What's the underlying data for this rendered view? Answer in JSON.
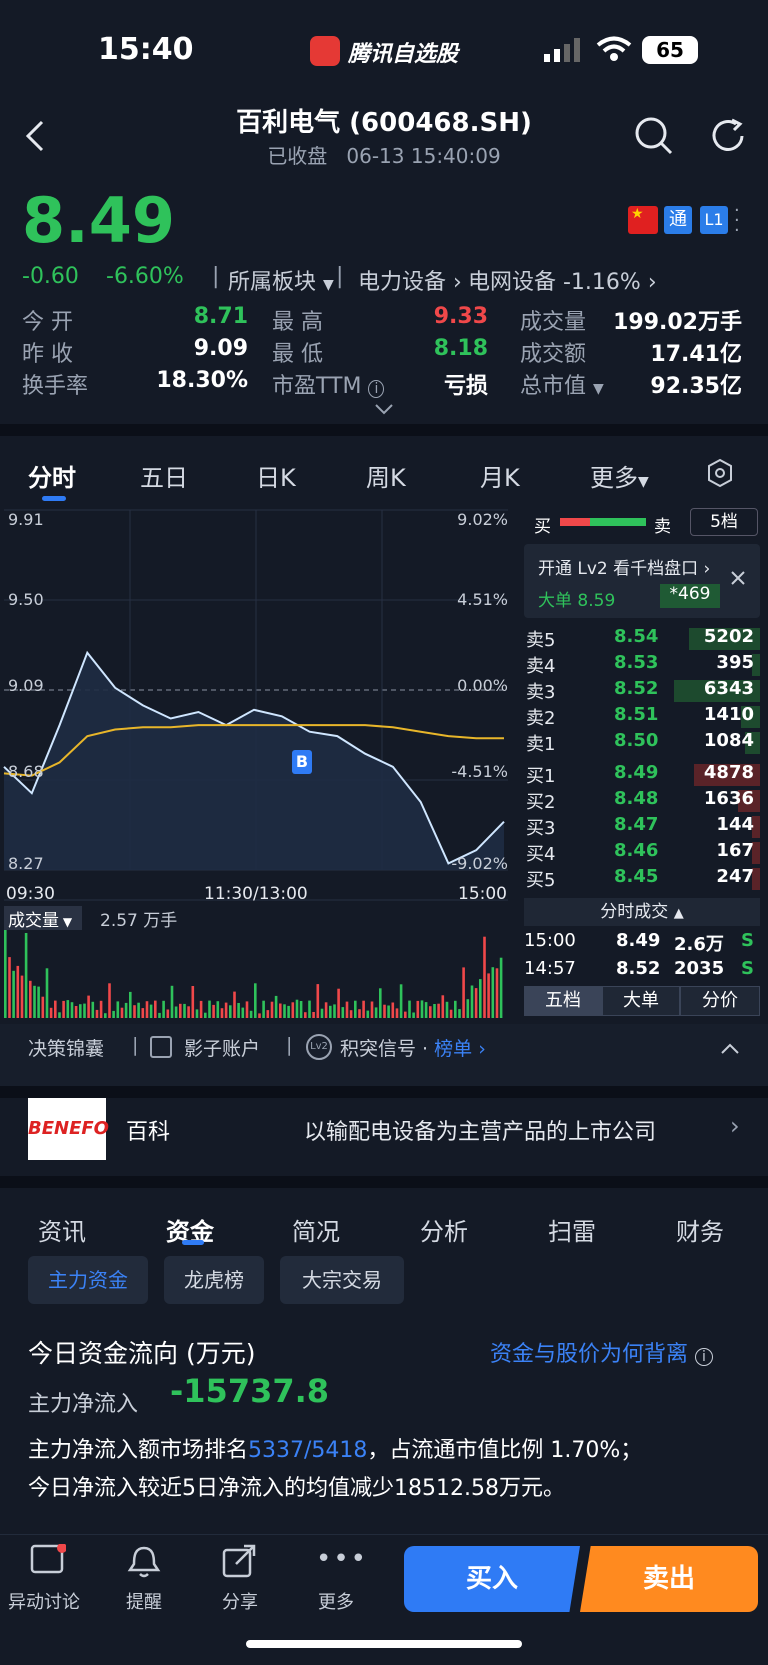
{
  "status": {
    "time": "15:40",
    "battery": "65"
  },
  "app": {
    "name": "腾讯自选股"
  },
  "header": {
    "title": "百利电气 (600468.SH)",
    "status": "已收盘",
    "datetime": "06-13 15:40:09"
  },
  "quote": {
    "price": "8.49",
    "change": "-0.60",
    "change_pct": "-6.60%",
    "sector_label": "所属板块",
    "sector1": "电力设备",
    "sector2": "电网设备 -1.16%",
    "badges": {
      "tong": "通",
      "level": "L1"
    },
    "stats": [
      {
        "label": "今 开",
        "value": "8.71"
      },
      {
        "label": "最 高",
        "value": "9.33"
      },
      {
        "label": "成交量",
        "value": "199.02万手"
      },
      {
        "label": "昨 收",
        "value": "9.09"
      },
      {
        "label": "最 低",
        "value": "8.18"
      },
      {
        "label": "成交额",
        "value": "17.41亿"
      },
      {
        "label": "换手率",
        "value": "18.30%"
      },
      {
        "label": "市盈TTM",
        "value": "亏损"
      },
      {
        "label": "总市值",
        "value": "92.35亿"
      }
    ]
  },
  "chart_tabs": [
    "分时",
    "五日",
    "日K",
    "周K",
    "月K",
    "更多"
  ],
  "chart": {
    "y_left": [
      "9.91",
      "9.50",
      "9.09",
      "8.68",
      "8.27"
    ],
    "y_right": [
      "9.02%",
      "4.51%",
      "0.00%",
      "-4.51%",
      "-9.02%"
    ],
    "x_labels": [
      "09:30",
      "11:30/13:00",
      "15:00"
    ],
    "marker": "B",
    "volume_label": "成交量",
    "volume_value": "2.57 万手"
  },
  "chart_data": {
    "type": "line",
    "x": [
      "09:30",
      "09:45",
      "10:00",
      "10:15",
      "10:30",
      "10:45",
      "11:00",
      "11:15",
      "11:30",
      "13:15",
      "13:30",
      "13:45",
      "14:00",
      "14:15",
      "14:30",
      "14:45",
      "14:50",
      "14:55",
      "15:00"
    ],
    "series": [
      {
        "values": [
          8.74,
          8.62,
          8.93,
          9.26,
          9.1,
          9.02,
          8.96,
          8.99,
          8.93,
          9.0,
          8.97,
          8.9,
          8.88,
          8.8,
          8.74,
          8.58,
          8.3,
          8.36,
          8.49
        ]
      },
      {
        "values": [
          8.71,
          8.7,
          8.76,
          8.88,
          8.91,
          8.92,
          8.92,
          8.93,
          8.93,
          8.93,
          8.93,
          8.93,
          8.93,
          8.93,
          8.92,
          8.9,
          8.88,
          8.87,
          8.87
        ]
      }
    ],
    "ylim": [
      8.27,
      9.91
    ]
  },
  "orderbook": {
    "buy_label": "买",
    "sell_label": "卖",
    "depth": "5档",
    "promo": "开通 Lv2 看千档盘口",
    "big_order": "大单 8.59",
    "big_vol": "*469",
    "asks": [
      {
        "label": "卖5",
        "price": "8.54",
        "vol": "5202"
      },
      {
        "label": "卖4",
        "price": "8.53",
        "vol": "395"
      },
      {
        "label": "卖3",
        "price": "8.52",
        "vol": "6343"
      },
      {
        "label": "卖2",
        "price": "8.51",
        "vol": "1410"
      },
      {
        "label": "卖1",
        "price": "8.50",
        "vol": "1084"
      }
    ],
    "bids": [
      {
        "label": "买1",
        "price": "8.49",
        "vol": "4878"
      },
      {
        "label": "买2",
        "price": "8.48",
        "vol": "1636"
      },
      {
        "label": "买3",
        "price": "8.47",
        "vol": "144"
      },
      {
        "label": "买4",
        "price": "8.46",
        "vol": "167"
      },
      {
        "label": "买5",
        "price": "8.45",
        "vol": "247"
      }
    ],
    "trades_title": "分时成交",
    "trades": [
      {
        "time": "15:00",
        "price": "8.49",
        "vol": "2.6万",
        "side": "S"
      },
      {
        "time": "14:57",
        "price": "8.52",
        "vol": "2035",
        "side": "S"
      }
    ],
    "tabs": [
      "五档",
      "大单",
      "分价"
    ]
  },
  "tools": {
    "t1": "决策锦囊",
    "t2": "影子账户",
    "t3": "积突信号",
    "t4": "榜单"
  },
  "baike": {
    "logo": "BENEFO",
    "label": "百科",
    "desc": "以输配电设备为主营产品的上市公司"
  },
  "section_tabs": [
    "资讯",
    "资金",
    "简况",
    "分析",
    "扫雷",
    "财务"
  ],
  "fund_tabs": [
    "主力资金",
    "龙虎榜",
    "大宗交易"
  ],
  "fund": {
    "title": "今日资金流向 (万元)",
    "link": "资金与股价为何背离",
    "net_label": "主力净流入",
    "net_value": "-15737.8",
    "desc1a": "主力净流入额市场排名",
    "rank": "5337/5418",
    "desc1b": "，占流通市值比例 1.70%；",
    "desc2": "今日净流入较近5日净流入的均值减少18512.58万元。"
  },
  "bottom_nav": [
    "异动讨论",
    "提醒",
    "分享",
    "更多"
  ],
  "actions": {
    "buy": "买入",
    "sell": "卖出"
  }
}
